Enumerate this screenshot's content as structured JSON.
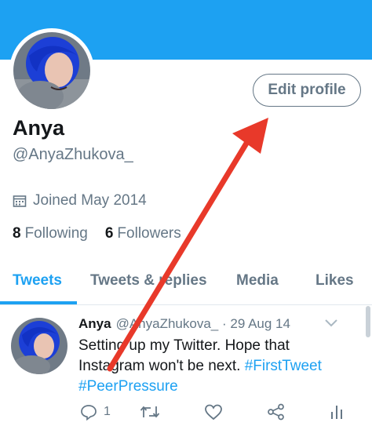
{
  "profile": {
    "name": "Anya",
    "handle": "@AnyaZhukova_",
    "joined": "Joined May 2014",
    "following_count": "8",
    "following_label": "Following",
    "followers_count": "6",
    "followers_label": "Followers",
    "edit_button": "Edit profile"
  },
  "tabs": [
    "Tweets",
    "Tweets & replies",
    "Media",
    "Likes"
  ],
  "active_tab": "Tweets",
  "tweet": {
    "author_name": "Anya",
    "author_handle": "@AnyaZhukova_",
    "date": "· 29 Aug 14",
    "text": "Setting up my Twitter. Hope that Instagram won't be next.",
    "hashtag1": "#FirstTweet",
    "hashtag2": "#PeerPressure",
    "reply_count": "1"
  },
  "colors": {
    "brand": "#1da1f2",
    "muted": "#657786",
    "annotation_arrow": "#e8392a"
  },
  "icons": [
    "calendar-icon",
    "chevron-down-icon",
    "reply-icon",
    "retweet-icon",
    "like-icon",
    "share-icon",
    "analytics-icon"
  ]
}
